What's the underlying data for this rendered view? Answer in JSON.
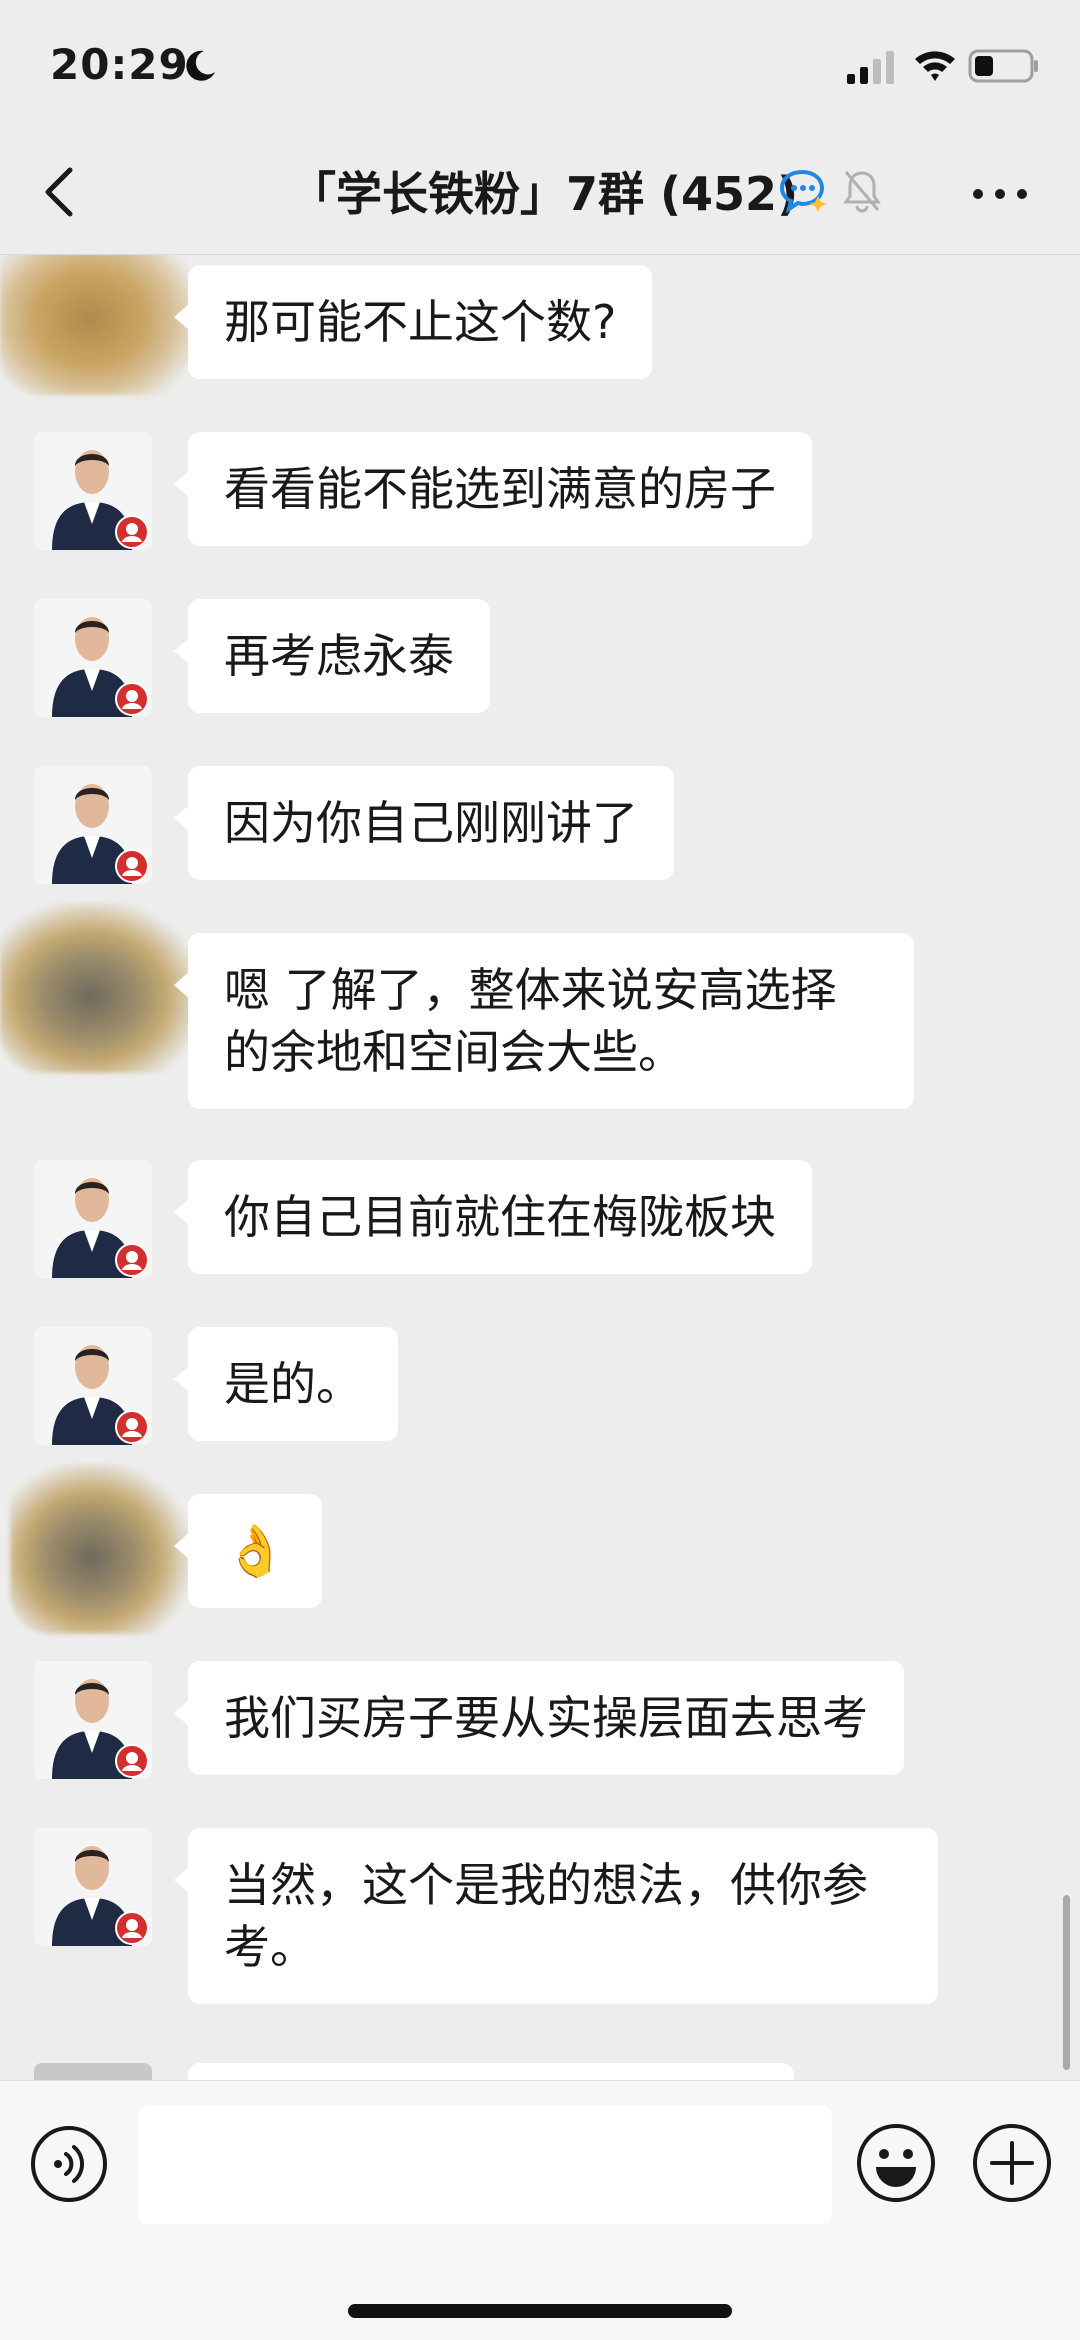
{
  "status_bar": {
    "time": "20:29"
  },
  "header": {
    "title": "「学长铁粉」7群 (452)"
  },
  "messages": [
    {
      "sender": "member-a",
      "text": "那可能不止这个数?"
    },
    {
      "sender": "agent",
      "text": "看看能不能选到满意的房子"
    },
    {
      "sender": "agent",
      "text": "再考虑永泰"
    },
    {
      "sender": "agent",
      "text": "因为你自己刚刚讲了"
    },
    {
      "sender": "member-b",
      "text": "嗯  了解了，整体来说安高选择的余地和空间会大些。"
    },
    {
      "sender": "agent",
      "text": "你自己目前就住在梅陇板块"
    },
    {
      "sender": "agent",
      "text": "是的。"
    },
    {
      "sender": "member-c",
      "text": "👌"
    },
    {
      "sender": "agent",
      "text": "我们买房子要从实操层面去思考"
    },
    {
      "sender": "agent",
      "text": "当然，这个是我的想法，供你参考。"
    }
  ],
  "colors": {
    "background": "#ededed",
    "bubble": "#ffffff",
    "accent_blue": "#1e88e5"
  }
}
